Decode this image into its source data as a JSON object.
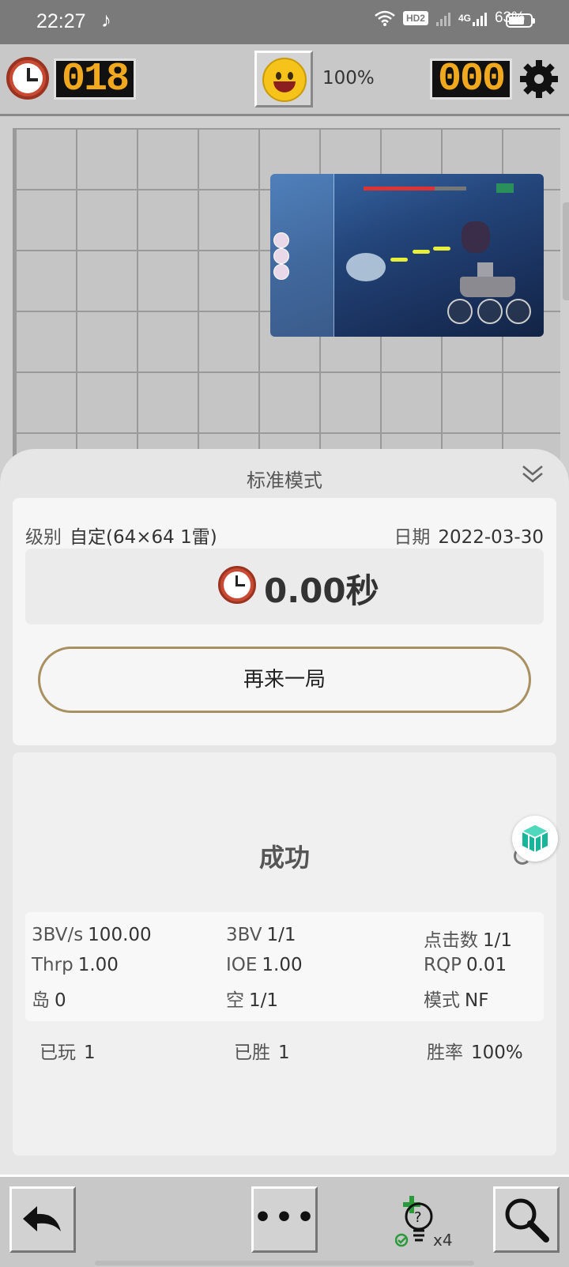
{
  "status_bar": {
    "time": "22:27",
    "network_badge": "HD2",
    "signal_label": "4G",
    "battery": "63%"
  },
  "top_bar": {
    "timer_value": "018",
    "face_percent": "100%",
    "mine_counter": "000"
  },
  "result_sheet": {
    "title": "标准模式",
    "level_label": "级别",
    "level_value": "自定(64×64  1雷)",
    "date_label": "日期",
    "date_value": "2022-03-30",
    "time_value": "0.00秒",
    "play_again_label": "再来一局",
    "result_text": "成功",
    "stats": [
      {
        "label": "3BV/s",
        "value": "100.00"
      },
      {
        "label": "3BV",
        "value": "1/1"
      },
      {
        "label": "点击数",
        "value": "1/1"
      },
      {
        "label": "Thrp",
        "value": "1.00"
      },
      {
        "label": "IOE",
        "value": "1.00"
      },
      {
        "label": "RQP",
        "value": "0.01"
      },
      {
        "label": "岛",
        "value": "0"
      },
      {
        "label": "空",
        "value": "1/1"
      },
      {
        "label": "模式",
        "value": "NF"
      }
    ],
    "summary": [
      {
        "label": "已玩",
        "value": "1"
      },
      {
        "label": "已胜",
        "value": "1"
      },
      {
        "label": "胜率",
        "value": "100%"
      }
    ]
  },
  "bottom_bar": {
    "more_label": "•••",
    "hint_count": "x4"
  },
  "colors": {
    "led_digits": "#f0a81e",
    "play_again_border": "#a89060",
    "hint_plus": "#2a9a3a"
  },
  "icons": [
    "clock-icon",
    "smiley-icon",
    "gear-icon",
    "chevron-double-down-icon",
    "back-arrow-icon",
    "more-icon",
    "hint-bulb-icon",
    "search-icon",
    "cube-icon"
  ]
}
